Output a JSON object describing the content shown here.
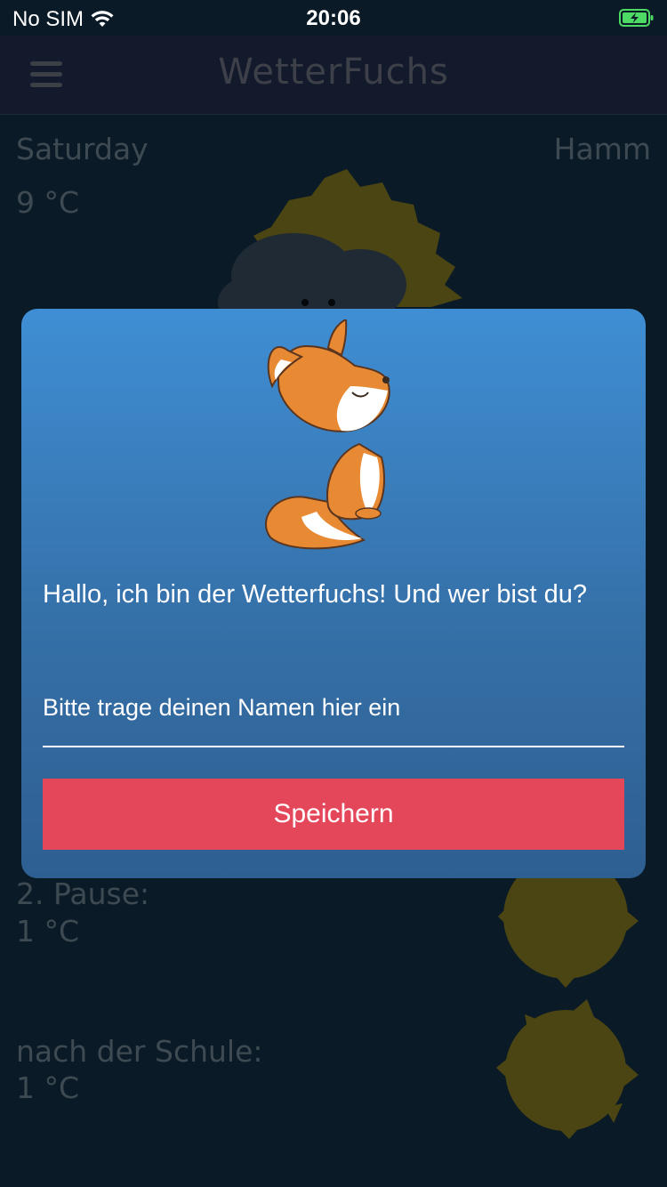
{
  "status_bar": {
    "carrier": "No SIM",
    "time": "20:06",
    "battery_color": "#4cd964"
  },
  "header": {
    "title": "WetterFuchs",
    "menu_icon": "hamburger-icon"
  },
  "background": {
    "day": "Saturday",
    "city": "Hamm",
    "current_temp": "9 °C",
    "pause_label": "2. Pause:",
    "pause_temp": "1 °C",
    "after_school_label": "nach der Schule:",
    "after_school_temp": "1 °C"
  },
  "dialog": {
    "greeting": "Hallo, ich bin der Wetterfuchs! Und wer bist du?",
    "name_placeholder": "Bitte trage deinen Namen hier ein",
    "name_value": "",
    "save_label": "Speichern",
    "mascot_icon": "fox-icon"
  },
  "colors": {
    "button": "#e5475a",
    "dialog_top": "#3f8ed4",
    "dialog_bottom": "#2e5f92"
  }
}
